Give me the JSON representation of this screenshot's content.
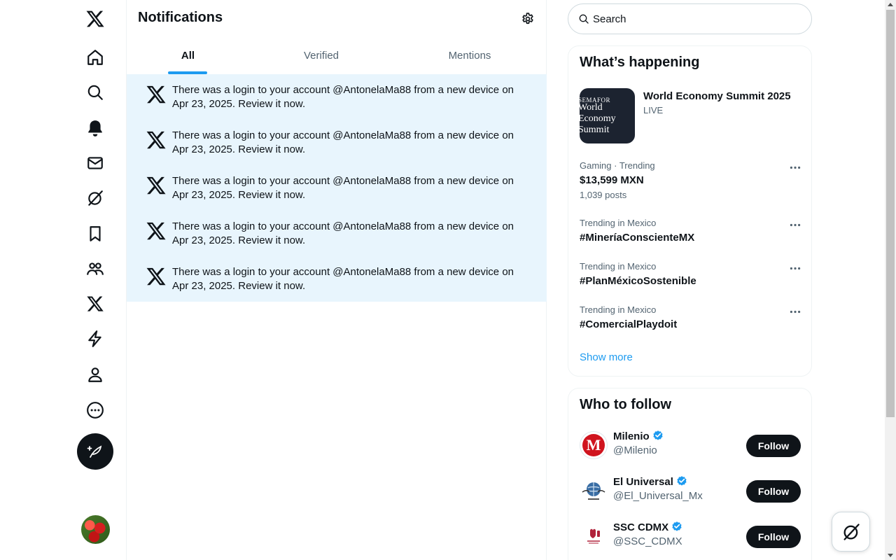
{
  "header": {
    "title": "Notifications"
  },
  "tabs": [
    {
      "label": "All",
      "active": true
    },
    {
      "label": "Verified",
      "active": false
    },
    {
      "label": "Mentions",
      "active": false
    }
  ],
  "notifications": [
    {
      "text": "There was a login to your account @AntonelaMa88 from a new device on Apr 23, 2025. Review it now."
    },
    {
      "text": "There was a login to your account @AntonelaMa88 from a new device on Apr 23, 2025. Review it now."
    },
    {
      "text": "There was a login to your account @AntonelaMa88 from a new device on Apr 23, 2025. Review it now."
    },
    {
      "text": "There was a login to your account @AntonelaMa88 from a new device on Apr 23, 2025. Review it now."
    },
    {
      "text": "There was a login to your account @AntonelaMa88 from a new device on Apr 23, 2025. Review it now."
    }
  ],
  "search": {
    "placeholder": "Search"
  },
  "happening": {
    "title": "What’s happening",
    "event": {
      "title": "World Economy Summit 2025",
      "status": "LIVE",
      "thumb_line1": "SEMAFOR",
      "thumb_line2": "World\nEconomy\nSummit"
    },
    "trends": [
      {
        "meta": "Gaming · Trending",
        "name": "$13,599 MXN",
        "count": "1,039 posts"
      },
      {
        "meta": "Trending in Mexico",
        "name": "#MineríaConscienteMX",
        "count": ""
      },
      {
        "meta": "Trending in Mexico",
        "name": "#PlanMéxicoSostenible",
        "count": ""
      },
      {
        "meta": "Trending in Mexico",
        "name": "#ComercialPlaydoit",
        "count": ""
      }
    ],
    "show_more": "Show more"
  },
  "who_to_follow": {
    "title": "Who to follow",
    "accounts": [
      {
        "name": "Milenio",
        "handle": "@Milenio",
        "button": "Follow",
        "avatar_letter": "M"
      },
      {
        "name": "El Universal",
        "handle": "@El_Universal_Mx",
        "button": "Follow"
      },
      {
        "name": "SSC CDMX",
        "handle": "@SSC_CDMX",
        "button": "Follow"
      }
    ]
  },
  "colors": {
    "accent": "#1d9bf0",
    "unread_bg": "#e8f5fd",
    "text": "#0f1419",
    "muted": "#536471"
  },
  "nav_icons": [
    "x-logo-icon",
    "home-icon",
    "explore-icon",
    "notifications-icon",
    "messages-icon",
    "grok-icon",
    "bookmarks-icon",
    "communities-icon",
    "premium-icon",
    "verified-orgs-icon",
    "profile-icon",
    "more-icon",
    "post-compose-icon"
  ]
}
